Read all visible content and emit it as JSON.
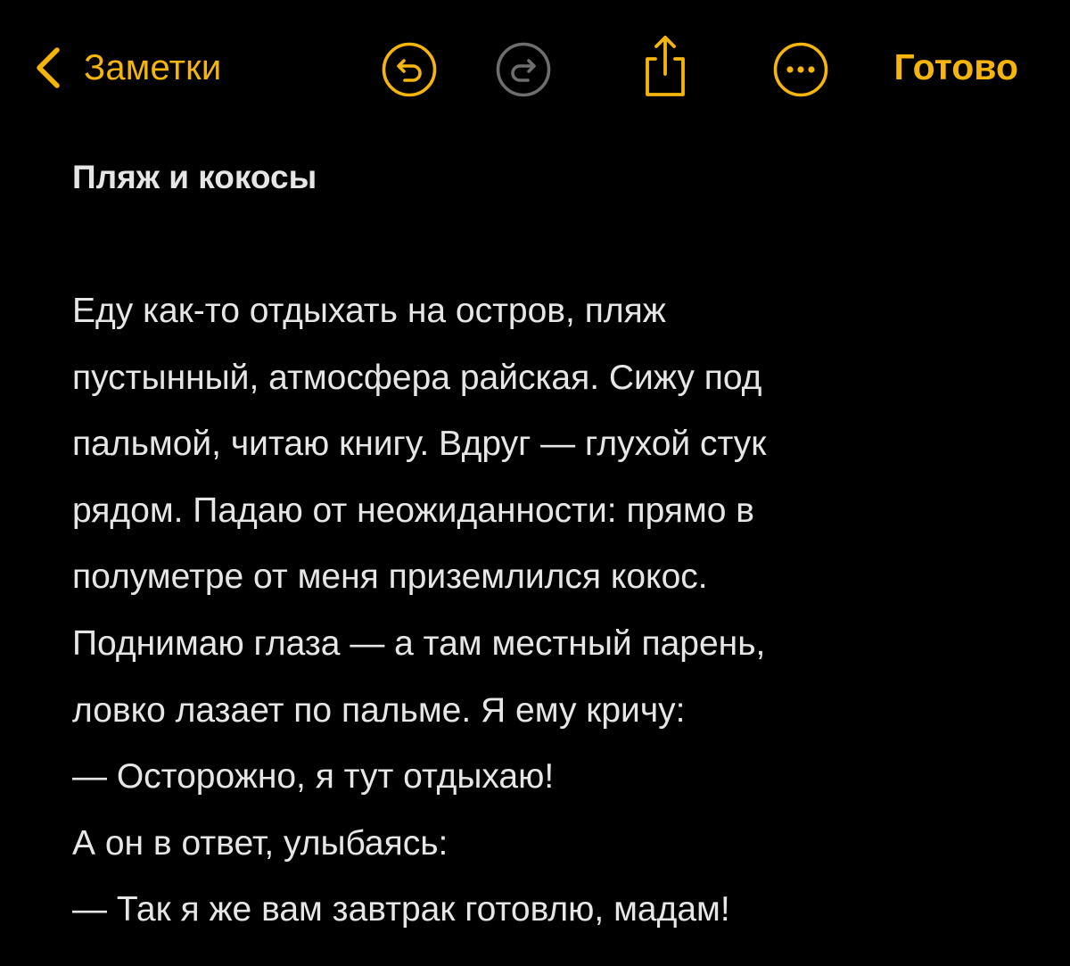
{
  "toolbar": {
    "back_label": "Заметки",
    "back_icon": "chevron-left-icon",
    "undo_icon": "undo-icon",
    "redo_icon": "redo-icon",
    "share_icon": "share-icon",
    "more_icon": "more-options-icon",
    "done_label": "Готово",
    "accent_color": "#f5b50a",
    "disabled_color": "#6e6e6e"
  },
  "note": {
    "title": "Пляж и кокосы",
    "lines": [
      "Еду как-то отдыхать на остров, пляж",
      "пустынный, атмосфера райская. Сижу под",
      "пальмой, читаю книгу. Вдруг — глухой стук",
      "рядом. Падаю от неожиданности: прямо в",
      "полуметре от меня приземлился кокос.",
      "Поднимаю глаза — а там местный парень,",
      "ловко лазает по пальме. Я ему кричу:",
      "— Осторожно, я тут отдыхаю!",
      "А он в ответ, улыбаясь:",
      "— Так я же вам завтрак готовлю, мадам!"
    ]
  },
  "colors": {
    "background": "#000000",
    "text": "#e6e6e6"
  }
}
